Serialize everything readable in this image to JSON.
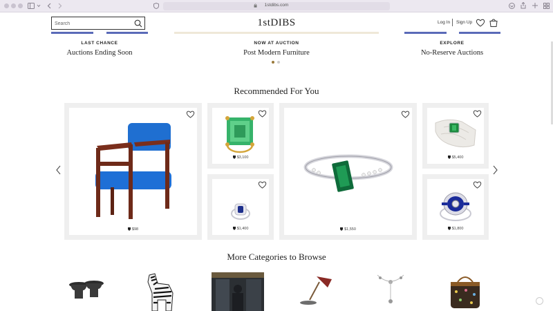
{
  "browser": {
    "url": "1stdibs.com",
    "icons": [
      "sidebar-icon",
      "back-icon",
      "forward-icon",
      "shield-icon",
      "download-icon",
      "share-icon",
      "new-tab-icon",
      "tab-overview-icon"
    ]
  },
  "header": {
    "search_placeholder": "Search",
    "logo": "1stDIBS",
    "login": "Log In",
    "signup": "Sign Up"
  },
  "promos": [
    {
      "label": "LAST CHANCE",
      "title": "Auctions Ending Soon"
    },
    {
      "label": "NOW AT AUCTION",
      "title": "Post Modern Furniture"
    },
    {
      "label": "EXPLORE",
      "title": "No-Reserve Auctions"
    }
  ],
  "carousel": {
    "active_dot": 1,
    "dot_count": 2
  },
  "recommended": {
    "title": "Recommended For You",
    "items": [
      {
        "name": "blue-armchair",
        "price": "$98"
      },
      {
        "name": "emerald-ring-yellow-prongs",
        "price": "$3,100"
      },
      {
        "name": "sapphire-ring-small",
        "price": "$1,400"
      },
      {
        "name": "emerald-diamond-band-ring",
        "price": "$1,550"
      },
      {
        "name": "emerald-ring-on-hand",
        "price": "$5,400"
      },
      {
        "name": "sapphire-halo-ring",
        "price": "$1,800"
      }
    ]
  },
  "categories": {
    "title": "More Categories to Browse",
    "items": [
      "side-tables",
      "zebra-sculpture",
      "photograph",
      "desk-lamp",
      "necklace",
      "handbag"
    ]
  },
  "colors": {
    "accent_blue": "#5a6ab8",
    "accent_cream": "#efe8d8",
    "dot_active": "#9a7a3c",
    "dot_inactive": "#cccccc",
    "card_bg": "#efefef"
  }
}
